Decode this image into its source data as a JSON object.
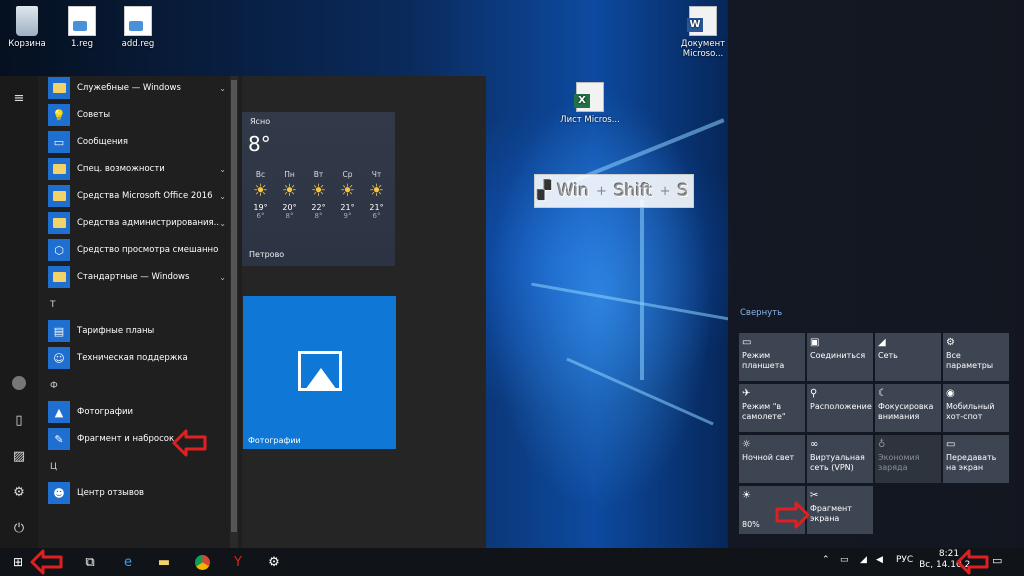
{
  "desktop": {
    "icons": [
      {
        "label": "Корзина",
        "icon": "recycle-bin-icon"
      },
      {
        "label": "1.reg",
        "icon": "reg-file-icon"
      },
      {
        "label": "add.reg",
        "icon": "reg-file-icon"
      },
      {
        "label": "Документ Microso...",
        "icon": "word-doc-icon"
      },
      {
        "label": "Лист Micros...",
        "icon": "excel-sheet-icon"
      }
    ],
    "shortcut_keys": [
      "Win",
      "+",
      "Shift",
      "+",
      "S"
    ]
  },
  "start_menu": {
    "apps": [
      {
        "label": "Служебные — Windows",
        "type": "folder",
        "expandable": true
      },
      {
        "label": "Советы",
        "type": "app",
        "icon": "lightbulb-icon"
      },
      {
        "label": "Сообщения",
        "type": "app",
        "icon": "chat-icon"
      },
      {
        "label": "Спец. возможности",
        "type": "folder",
        "expandable": true
      },
      {
        "label": "Средства Microsoft Office 2016",
        "type": "folder",
        "expandable": true
      },
      {
        "label": "Средства администрирования...",
        "type": "folder",
        "expandable": true
      },
      {
        "label": "Средство просмотра смешанной р...",
        "type": "app",
        "icon": "cube-icon"
      },
      {
        "label": "Стандартные — Windows",
        "type": "folder",
        "expandable": true
      }
    ],
    "letter_t": "Т",
    "apps_t": [
      {
        "label": "Тарифные планы",
        "icon": "bars-icon"
      },
      {
        "label": "Техническая поддержка",
        "icon": "support-icon"
      }
    ],
    "letter_f": "Ф",
    "apps_f": [
      {
        "label": "Фотографии",
        "icon": "photos-icon"
      },
      {
        "label": "Фрагмент и набросок",
        "icon": "snip-sketch-icon"
      }
    ],
    "letter_ts": "Ц",
    "apps_ts": [
      {
        "label": "Центр отзывов",
        "icon": "feedback-icon"
      }
    ]
  },
  "weather": {
    "condition": "Ясно",
    "temp": "8°",
    "days": [
      {
        "name": "Вс",
        "hi": "19°",
        "lo": "6°"
      },
      {
        "name": "Пн",
        "hi": "20°",
        "lo": "8°"
      },
      {
        "name": "Вт",
        "hi": "22°",
        "lo": "8°"
      },
      {
        "name": "Ср",
        "hi": "21°",
        "lo": "9°"
      },
      {
        "name": "Чт",
        "hi": "21°",
        "lo": "6°"
      }
    ],
    "city": "Петрово"
  },
  "photos_tile": {
    "label": "Фотографии"
  },
  "action_center": {
    "collapse": "Свернуть",
    "tiles": [
      {
        "label": "Режим планшета",
        "icon": "tablet-icon",
        "off": false
      },
      {
        "label": "Соединиться",
        "icon": "connect-icon",
        "off": false
      },
      {
        "label": "Сеть",
        "icon": "network-icon",
        "off": false
      },
      {
        "label": "Все параметры",
        "icon": "gear-icon",
        "off": false
      },
      {
        "label": "Режим \"в самолете\"",
        "icon": "airplane-icon",
        "off": false
      },
      {
        "label": "Расположение",
        "icon": "location-icon",
        "off": false
      },
      {
        "label": "Фокусировка внимания",
        "icon": "moon-icon",
        "off": false
      },
      {
        "label": "Мобильный хот-спот",
        "icon": "hotspot-icon",
        "off": false
      },
      {
        "label": "Ночной свет",
        "icon": "sun-icon",
        "off": false
      },
      {
        "label": "Виртуальная сеть (VPN)",
        "icon": "vpn-icon",
        "off": false
      },
      {
        "label": "Экономия заряда",
        "icon": "battery-saver-icon",
        "off": true
      },
      {
        "label": "Передавать на экран",
        "icon": "project-icon",
        "off": false
      },
      {
        "label": "80%",
        "icon": "brightness-icon",
        "off": false
      },
      {
        "label": "Фрагмент экрана",
        "icon": "screen-snip-icon",
        "off": false
      }
    ]
  },
  "taskbar": {
    "lang": "РУС",
    "time": "8:21",
    "date": "Вс, 14.10.2..."
  }
}
